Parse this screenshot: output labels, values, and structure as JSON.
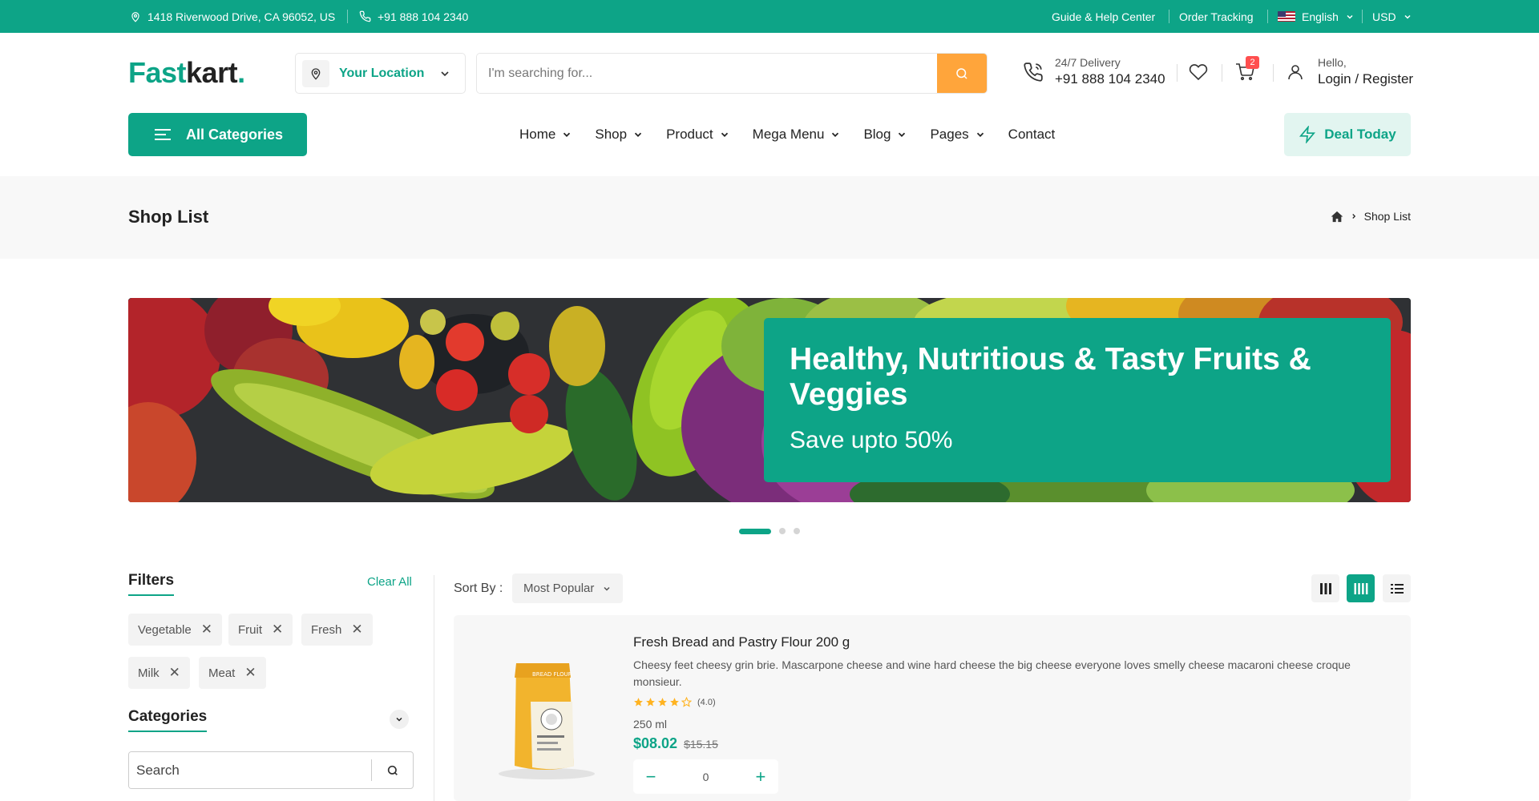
{
  "topbar": {
    "address": "1418 Riverwood Drive, CA 96052, US",
    "phone": "+91 888 104 2340",
    "guide": "Guide & Help Center",
    "tracking": "Order Tracking",
    "language": "English",
    "currency": "USD"
  },
  "header": {
    "logo_part1": "Fast",
    "logo_part2": "kart",
    "logo_dot": ".",
    "location_label": "Your Location",
    "search_placeholder": "I'm searching for...",
    "delivery_label": "24/7 Delivery",
    "delivery_phone": "+91 888 104 2340",
    "cart_count": "2",
    "hello": "Hello,",
    "login": "Login / Register"
  },
  "nav": {
    "all_categories": "All Categories",
    "items": [
      "Home",
      "Shop",
      "Product",
      "Mega Menu",
      "Blog",
      "Pages",
      "Contact"
    ],
    "deal": "Deal Today"
  },
  "breadcrumb": {
    "title": "Shop List",
    "current": "Shop List"
  },
  "banner": {
    "title": "Healthy, Nutritious & Tasty Fruits & Veggies",
    "subtitle": "Save upto 50%"
  },
  "filters": {
    "title": "Filters",
    "clear_all": "Clear All",
    "chips": [
      "Vegetable",
      "Fruit",
      "Fresh",
      "Milk",
      "Meat"
    ],
    "categories_title": "Categories",
    "category_search_placeholder": "Search"
  },
  "sort": {
    "label": "Sort By :",
    "selected": "Most Popular"
  },
  "product": {
    "name": "Fresh Bread and Pastry Flour 200 g",
    "description": "Cheesy feet cheesy grin brie. Mascarpone cheese and wine hard cheese the big cheese everyone loves smelly cheese macaroni cheese croque monsieur.",
    "rating": 4.0,
    "rating_text": "(4.0)",
    "unit": "250 ml",
    "price": "$08.02",
    "old_price": "$15.15",
    "quantity": "0",
    "package_label": "BREAD FLOUR"
  },
  "colors": {
    "primary": "#0da487",
    "accent": "#ffa53b",
    "badge": "#ff4f4f"
  }
}
